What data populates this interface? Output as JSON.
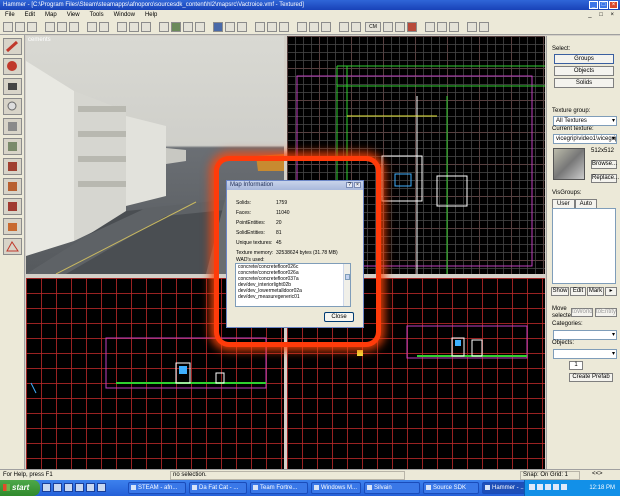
{
  "window": {
    "title": "Hammer - [C:\\Program Files\\Steam\\steamapps\\afnoporo\\sourcesdk_content\\hl2\\mapsrc\\Vactroice.vmf - Textured]",
    "controls": [
      "_",
      "□",
      "×"
    ]
  },
  "menu": [
    "File",
    "Edit",
    "Map",
    "View",
    "Tools",
    "Window",
    "Help"
  ],
  "viewports": {
    "three_d_label": "cements",
    "three_d_view": "camera"
  },
  "dialog": {
    "title": "Map Information",
    "stats": [
      {
        "label": "Solids:",
        "value": "1759"
      },
      {
        "label": "Faces:",
        "value": "11040"
      },
      {
        "label": "PointEntities:",
        "value": "20"
      },
      {
        "label": "SolidEntities:",
        "value": "81"
      },
      {
        "label": "Unique textures:",
        "value": "45"
      },
      {
        "label": "Texture memory:",
        "value": "32538624 bytes (31.78 MB)"
      }
    ],
    "wads_label": "WAD's used:",
    "textures": [
      "concrete/concretefloor026c",
      "concrete/concretefloor026a",
      "concrete/concretefloor037a",
      "dev/dev_interiorlight02b",
      "dev/dev_lowermetalldoor02a",
      "dev/dev_measuregeneric01"
    ],
    "close_label": "Close"
  },
  "right_panel": {
    "select_label": "Select:",
    "select_buttons": [
      "Groups",
      "Objects",
      "Solids"
    ],
    "texture_group_label": "Texture group:",
    "texture_group_value": "All Textures",
    "current_texture_label": "Current texture:",
    "current_texture_value": "vicegrip\\video1\\vicegrip",
    "texture_size": "512x512",
    "browse_label": "Browse...",
    "replace_label": "Replace...",
    "visgroups_label": "VisGroups:",
    "tabs": [
      "User",
      "Auto"
    ],
    "vis_buttons": [
      "Show",
      "Edit",
      "Mark"
    ],
    "move_selected_label": "Move selected:",
    "to_world_label": "toWorld",
    "to_entity_label": "toEntity",
    "categories_label": "Categories:",
    "objects_label": "Objects:",
    "spin_value": "1",
    "create_prefab_label": "Create Prefab"
  },
  "status": {
    "help": "For Help, press F1",
    "selection": "no selection.",
    "snap": "Snap: On Grid: 1",
    "extra": "<<>"
  },
  "taskbar": {
    "start": "start",
    "buttons": [
      "STEAM - afn...",
      "Da Fat Cat - ...",
      "Team Fortre...",
      "Windows M...",
      "Silvain",
      "Source SDK",
      "Hammer - ..."
    ],
    "clock": "12:18 PM"
  }
}
